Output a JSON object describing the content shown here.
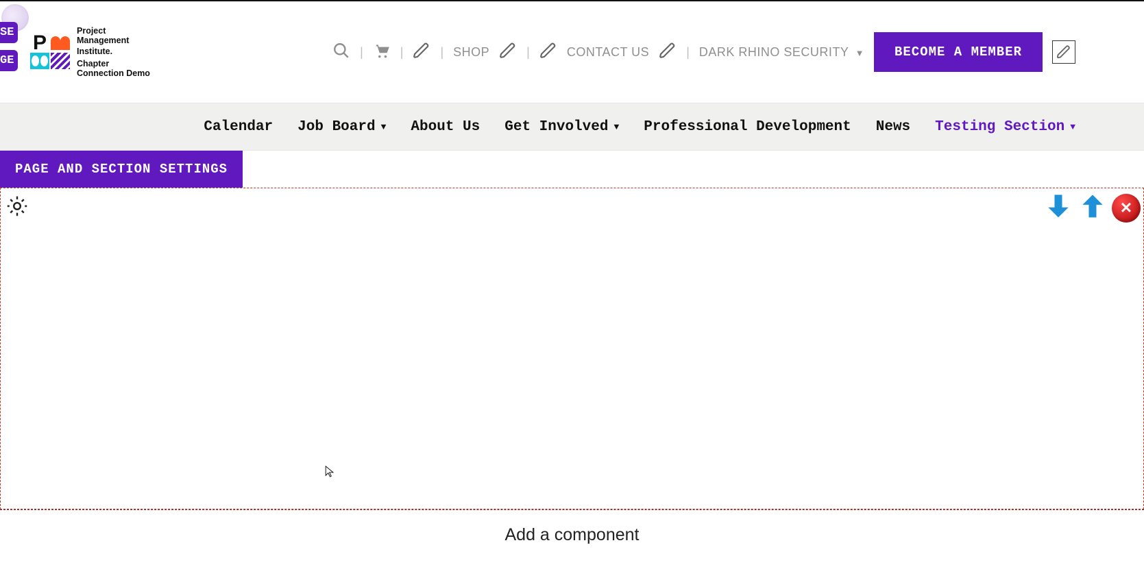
{
  "left_pills": {
    "p1": "SE",
    "p2": "GE"
  },
  "logo": {
    "line1": "Project",
    "line2": "Management",
    "line3": "Institute.",
    "line4a": "Chapter",
    "line4b": "Connection Demo"
  },
  "utilities": {
    "shop": "SHOP",
    "contact": "CONTACT US",
    "user_menu": "DARK RHINO SECURITY"
  },
  "cta_label": "BECOME A MEMBER",
  "nav": {
    "items": [
      {
        "label": "Calendar",
        "dropdown": false,
        "active": false
      },
      {
        "label": "Job Board",
        "dropdown": true,
        "active": false
      },
      {
        "label": "About Us",
        "dropdown": false,
        "active": false
      },
      {
        "label": "Get Involved",
        "dropdown": true,
        "active": false
      },
      {
        "label": "Professional Development",
        "dropdown": false,
        "active": false
      },
      {
        "label": "News",
        "dropdown": false,
        "active": false
      },
      {
        "label": "Testing Section",
        "dropdown": true,
        "active": true
      }
    ]
  },
  "page_settings_label": "PAGE AND SECTION SETTINGS",
  "add_component_label": "Add a component",
  "colors": {
    "brand_purple": "#6018bf",
    "arrow_blue": "#1e90d8",
    "delete_red": "#d62424"
  }
}
